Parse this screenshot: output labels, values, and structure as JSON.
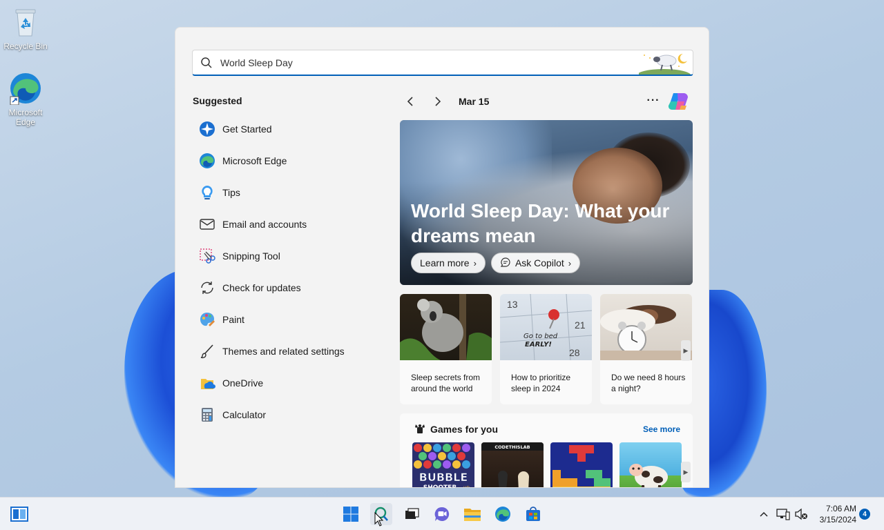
{
  "desktop": {
    "icons": [
      {
        "label": "Recycle Bin",
        "icon": "recycle-bin-icon"
      },
      {
        "label": "Microsoft Edge",
        "icon": "edge-icon"
      }
    ]
  },
  "search": {
    "query": "World Sleep Day",
    "highlight_art": "sheep-moon-illustration"
  },
  "suggested": {
    "title": "Suggested",
    "items": [
      {
        "label": "Get Started",
        "icon": "get-started-icon"
      },
      {
        "label": "Microsoft Edge",
        "icon": "edge-icon"
      },
      {
        "label": "Tips",
        "icon": "tips-icon"
      },
      {
        "label": "Email and accounts",
        "icon": "mail-icon"
      },
      {
        "label": "Snipping Tool",
        "icon": "snipping-tool-icon"
      },
      {
        "label": "Check for updates",
        "icon": "update-icon"
      },
      {
        "label": "Paint",
        "icon": "paint-icon"
      },
      {
        "label": "Themes and related settings",
        "icon": "brush-icon"
      },
      {
        "label": "OneDrive",
        "icon": "onedrive-icon"
      },
      {
        "label": "Calculator",
        "icon": "calculator-icon"
      }
    ]
  },
  "highlights": {
    "date": "Mar 15",
    "more_label": "···",
    "hero": {
      "title": "World Sleep Day: What your dreams mean",
      "learn_more": "Learn more",
      "ask_copilot": "Ask Copilot"
    },
    "cards": [
      {
        "caption": "Sleep secrets from around the world"
      },
      {
        "caption": "How to prioritize sleep in 2024",
        "image_text": "Go to bed EARLY!"
      },
      {
        "caption": "Do we need 8 hours a night?"
      }
    ],
    "games": {
      "title": "Games for you",
      "see_more": "See more",
      "tiles": [
        {
          "name": "Bubble Shooter",
          "text": "BUBBLE SHOOTER HD"
        },
        {
          "name": "Chess",
          "text": "CODETHISLAB"
        },
        {
          "name": "Block puzzle",
          "text": ""
        },
        {
          "name": "Farm game",
          "text": ""
        }
      ]
    }
  },
  "taskbar": {
    "apps": [
      "start-icon",
      "search-icon",
      "task-view-icon",
      "teams-chat-icon",
      "file-explorer-icon",
      "edge-icon",
      "store-icon"
    ],
    "time": "7:06 AM",
    "date": "3/15/2024",
    "notification_count": "4",
    "colors": {
      "accent": "#005fb8"
    }
  }
}
